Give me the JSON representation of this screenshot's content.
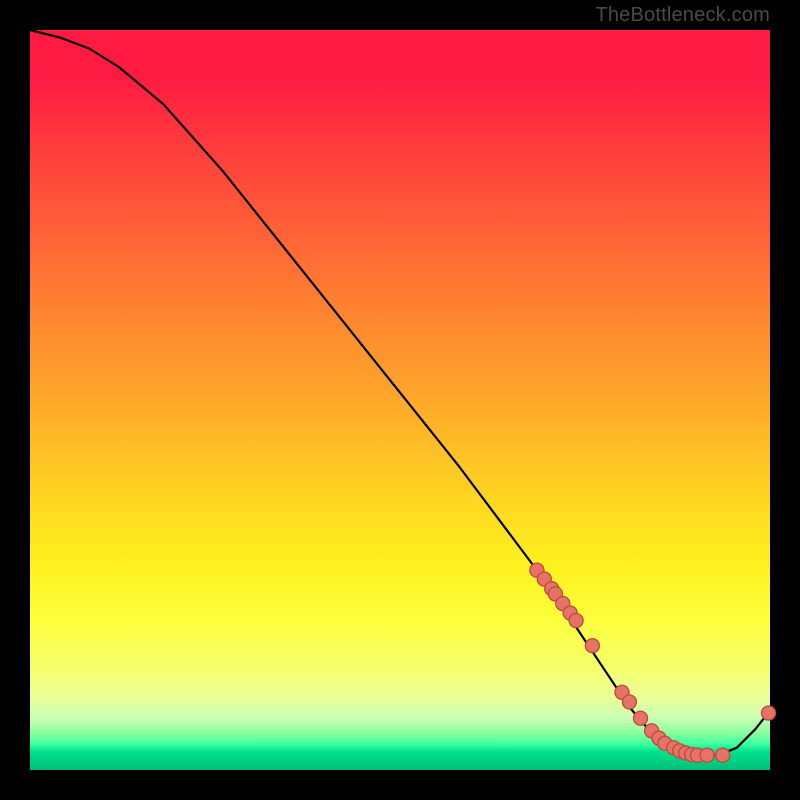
{
  "watermark": "TheBottleneck.com",
  "colors": {
    "dot_fill": "#e57368",
    "dot_stroke": "#c24a40",
    "curve": "#000000",
    "background": "#000000"
  },
  "chart_data": {
    "type": "line",
    "title": "",
    "xlabel": "",
    "ylabel": "",
    "xlim": [
      0,
      100
    ],
    "ylim": [
      0,
      100
    ],
    "series": [
      {
        "name": "bottleneck-curve",
        "x": [
          0,
          4,
          8,
          12,
          18,
          26,
          34,
          42,
          50,
          58,
          64,
          70,
          74,
          78,
          81,
          84,
          87,
          90,
          93,
          95.5,
          98,
          100
        ],
        "y": [
          100,
          99,
          97.5,
          95,
          90,
          81,
          71,
          61,
          51,
          41,
          33,
          25,
          19,
          13,
          8.5,
          5,
          3,
          2,
          2,
          3,
          5.5,
          8
        ]
      }
    ],
    "dots": {
      "name": "marked-points",
      "x": [
        68.5,
        69.5,
        70.5,
        71.0,
        72.0,
        73.0,
        73.8,
        76.0,
        80.0,
        81.0,
        82.5,
        84.0,
        85.0,
        85.8,
        87.0,
        87.8,
        88.6,
        89.4,
        90.2,
        91.5,
        93.6,
        99.8
      ],
      "y": [
        27.0,
        25.8,
        24.5,
        23.8,
        22.5,
        21.2,
        20.2,
        16.8,
        10.5,
        9.2,
        7.0,
        5.3,
        4.3,
        3.6,
        3.0,
        2.6,
        2.3,
        2.1,
        2.0,
        2.0,
        2.0,
        7.7
      ]
    }
  }
}
